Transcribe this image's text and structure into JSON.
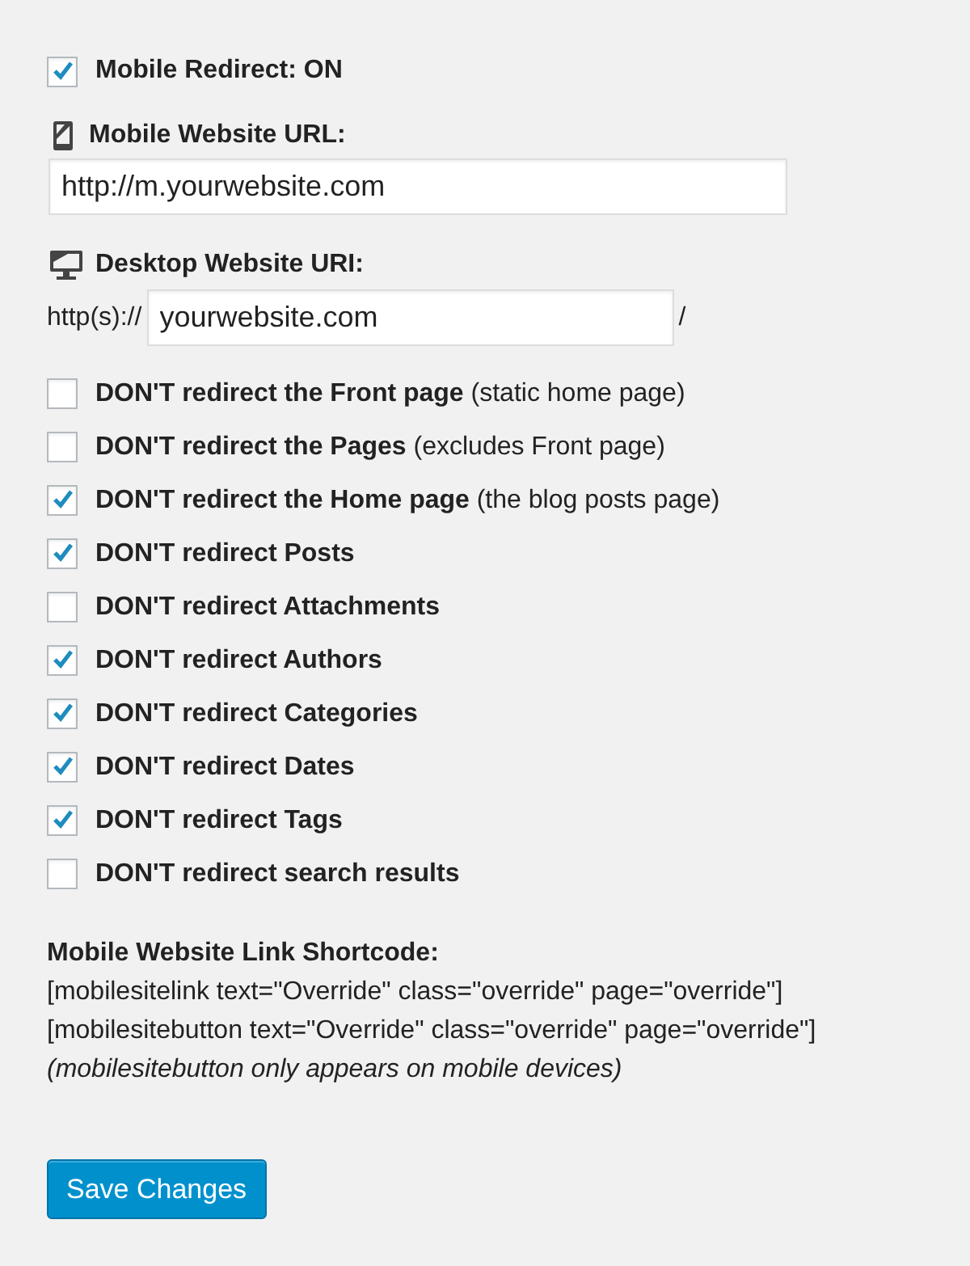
{
  "mobile_redirect": {
    "label": "Mobile Redirect: ON",
    "checked": true
  },
  "mobile_url": {
    "label": "Mobile Website URL:",
    "value": "http://m.yourwebsite.com"
  },
  "desktop_url": {
    "label": "Desktop Website URI:",
    "prefix": "http(s)://",
    "value": "yourwebsite.com",
    "suffix": "/"
  },
  "options": [
    {
      "label": "**DON'T redirect the Front page** (static home page)",
      "checked": false
    },
    {
      "label": "**DON'T redirect the Pages** (excludes Front page)",
      "checked": false
    },
    {
      "label": "**DON'T redirect the Home page** (the blog posts page)",
      "checked": true
    },
    {
      "label": "**DON'T redirect Posts**",
      "checked": true
    },
    {
      "label": "**DON'T redirect Attachments**",
      "checked": false
    },
    {
      "label": "**DON'T redirect Authors**",
      "checked": true
    },
    {
      "label": "**DON'T redirect Categories**",
      "checked": true
    },
    {
      "label": "**DON'T redirect Dates**",
      "checked": true
    },
    {
      "label": "**DON'T redirect Tags**",
      "checked": true
    },
    {
      "label": "**DON'T redirect search results**",
      "checked": false
    }
  ],
  "shortcode": {
    "title": "Mobile Website Link Shortcode:",
    "lines": [
      "[mobilesitelink text=\"Override\" class=\"override\" page=\"override\"]",
      "[mobilesitebutton text=\"Override\" class=\"override\" page=\"override\"]"
    ],
    "note": "(mobilesitebutton only appears on mobile devices)"
  },
  "buttons": [
    "Save Changes"
  ]
}
